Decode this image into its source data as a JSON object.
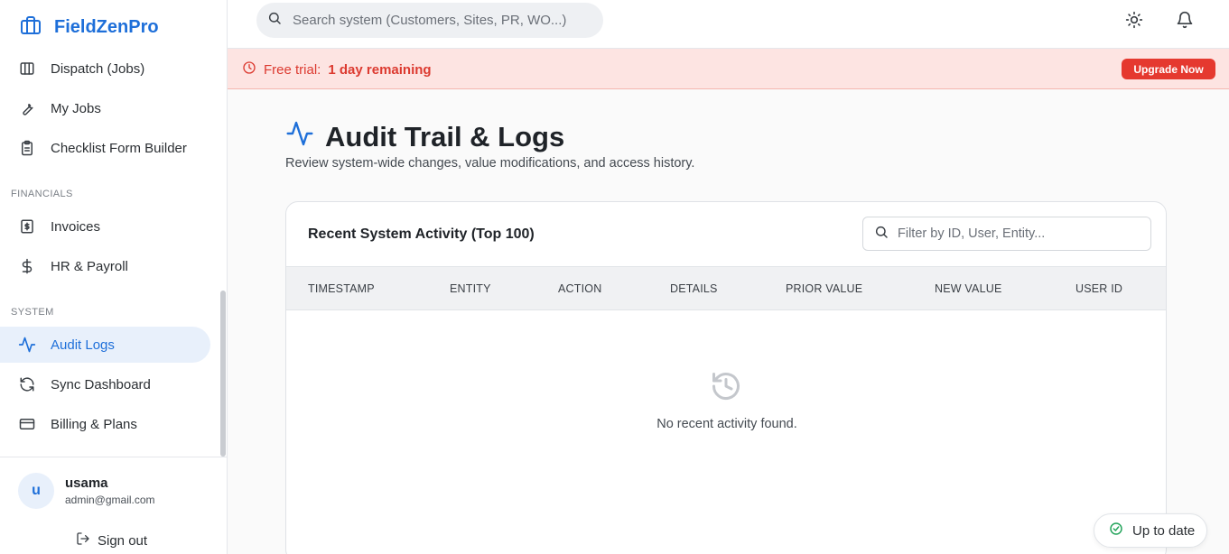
{
  "brand": {
    "name": "FieldZenPro"
  },
  "sidebar": {
    "items": [
      {
        "label": "Dispatch (Jobs)",
        "icon": "columns-icon"
      },
      {
        "label": "My Jobs",
        "icon": "wrench-icon"
      },
      {
        "label": "Checklist Form Builder",
        "icon": "clipboard-icon"
      },
      {
        "label": "Invoices",
        "icon": "invoice-dollar-icon"
      },
      {
        "label": "HR & Payroll",
        "icon": "dollar-icon"
      },
      {
        "label": "Audit Logs",
        "icon": "activity-icon",
        "active": true
      },
      {
        "label": "Sync Dashboard",
        "icon": "refresh-icon"
      },
      {
        "label": "Billing & Plans",
        "icon": "credit-card-icon"
      }
    ],
    "sections": {
      "financials": "FINANCIALS",
      "system": "SYSTEM"
    }
  },
  "user": {
    "initial": "u",
    "name": "usama",
    "email": "admin@gmail.com",
    "signout_label": "Sign out"
  },
  "topbar": {
    "search_placeholder": "Search system (Customers, Sites, PR, WO...)"
  },
  "banner": {
    "prefix": "Free trial:",
    "remaining": "1 day remaining",
    "upgrade_label": "Upgrade Now"
  },
  "page": {
    "title": "Audit Trail & Logs",
    "subtitle": "Review system-wide changes, value modifications, and access history."
  },
  "card": {
    "title": "Recent System Activity (Top 100)",
    "filter_placeholder": "Filter by ID, User, Entity...",
    "columns": [
      "TIMESTAMP",
      "ENTITY",
      "ACTION",
      "DETAILS",
      "PRIOR VALUE",
      "NEW VALUE",
      "USER ID"
    ],
    "empty_text": "No recent activity found."
  },
  "status": {
    "label": "Up to date"
  },
  "colors": {
    "accent": "#1e6fd9",
    "danger": "#e5392f",
    "success": "#22a35a"
  }
}
